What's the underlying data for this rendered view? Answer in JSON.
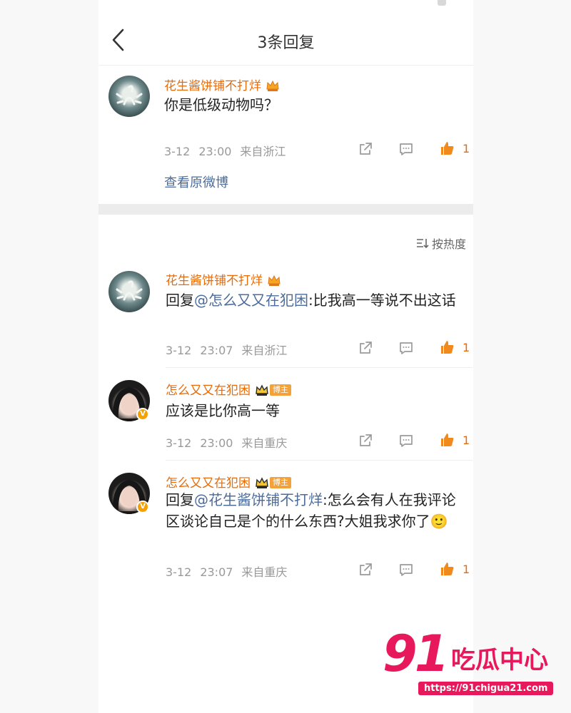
{
  "header": {
    "title": "3条回复"
  },
  "original": {
    "user": "花生酱饼铺不打烊",
    "text": "你是低级动物吗？",
    "date": "3-12",
    "time": "23:00",
    "location": "来自浙江",
    "likes": "1",
    "view_original": "查看原微博"
  },
  "sort_label": "按热度",
  "replies": [
    {
      "user": "花生酱饼铺不打烊",
      "reply_prefix": "回复",
      "mention": "@怎么又又在犯困",
      "text": ":比我高一等说不出这话",
      "date": "3-12",
      "time": "23:07",
      "location": "来自浙江",
      "likes": "1"
    },
    {
      "user": "怎么又又在犯困",
      "badge": "博主",
      "text": "应该是比你高一等",
      "date": "3-12",
      "time": "23:00",
      "location": "来自重庆",
      "likes": "1"
    },
    {
      "user": "怎么又又在犯困",
      "badge": "博主",
      "reply_prefix": "回复",
      "mention": "@花生酱饼铺不打烊",
      "text": ":怎么会有人在我评论区谈论自己是个的什么东西?大姐我求你了",
      "emoji": "🙂",
      "date": "3-12",
      "time": "23:07",
      "location": "来自重庆",
      "likes": "1"
    }
  ],
  "watermark": {
    "number": "91",
    "name": "吃瓜中心",
    "url": "https://91chigua21.com"
  },
  "colors": {
    "accent_orange": "#e86b0a",
    "link_blue": "#4c6c9b",
    "watermark_pink": "#e8185c"
  }
}
